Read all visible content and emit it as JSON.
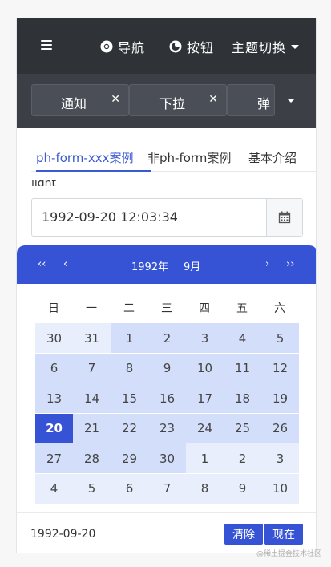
{
  "topnav": {
    "nav_label": "导航",
    "button_label": "按钮",
    "theme_label": "主题切换"
  },
  "tabs": {
    "items": [
      {
        "label": "通知"
      },
      {
        "label": "下拉"
      },
      {
        "label": "弹"
      }
    ]
  },
  "content_tabs": [
    {
      "label": "ph-form-xxx案例"
    },
    {
      "label": "非ph-form案例"
    },
    {
      "label": "基本介绍"
    }
  ],
  "peek_text": "light",
  "date_input": {
    "value": "1992-09-20 12:03:34"
  },
  "calendar": {
    "year": "1992年",
    "month": "9月",
    "weekdays": [
      "日",
      "一",
      "二",
      "三",
      "四",
      "五",
      "六"
    ],
    "days": [
      [
        "30",
        "31",
        "1",
        "2",
        "3",
        "4",
        "5"
      ],
      [
        "6",
        "7",
        "8",
        "9",
        "10",
        "11",
        "12"
      ],
      [
        "13",
        "14",
        "15",
        "16",
        "17",
        "18",
        "19"
      ],
      [
        "20",
        "21",
        "22",
        "23",
        "24",
        "25",
        "26"
      ],
      [
        "27",
        "28",
        "29",
        "30",
        "1",
        "2",
        "3"
      ],
      [
        "4",
        "5",
        "6",
        "7",
        "8",
        "9",
        "10"
      ]
    ],
    "selected_day": "20",
    "footer_date": "1992-09-20",
    "clear_label": "清除",
    "now_label": "现在"
  },
  "watermark": "@稀土掘金技术社区"
}
